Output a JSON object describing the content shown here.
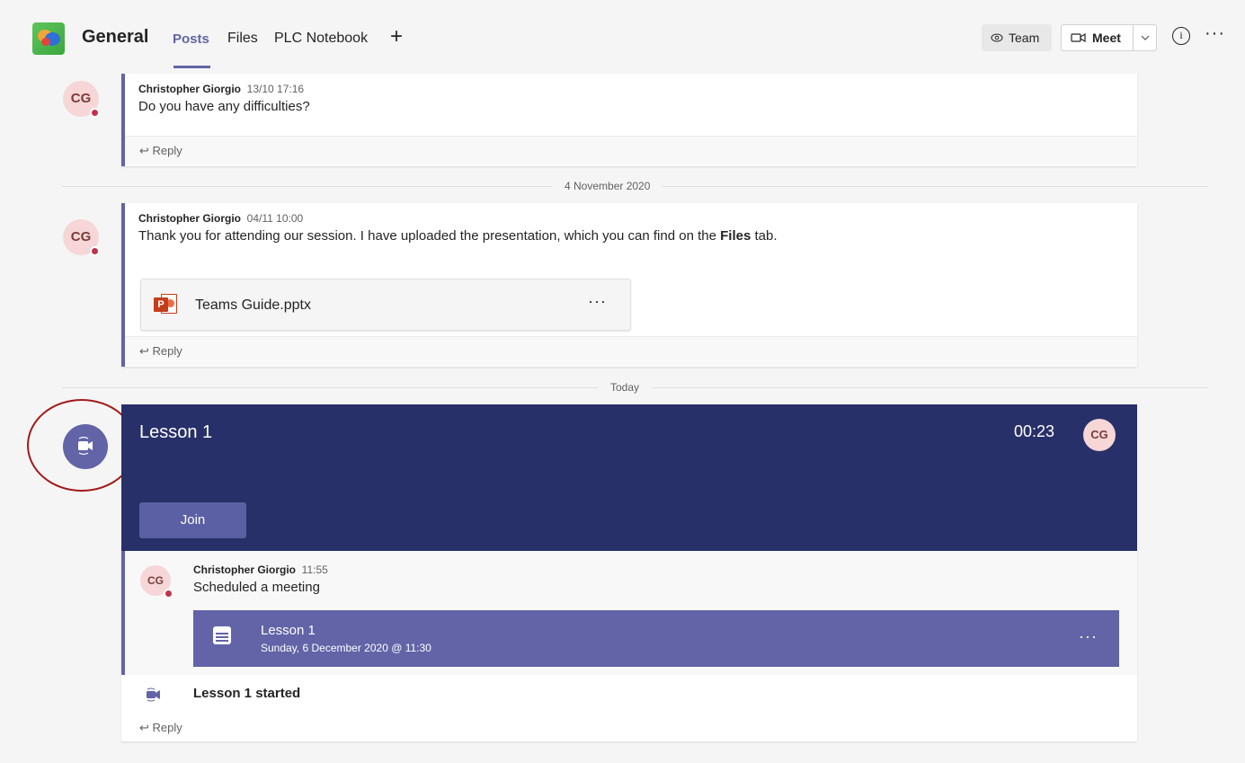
{
  "header": {
    "channel": "General",
    "tabs": [
      "Posts",
      "Files",
      "PLC Notebook"
    ],
    "add_tab": "+",
    "team_button": "Team",
    "meet_button": "Meet",
    "info": "i",
    "more": "···"
  },
  "posts": [
    {
      "author": "Christopher Giorgio",
      "time": "13/10 17:16",
      "text": "Do you have any difficulties?",
      "reply": "Reply",
      "initials": "CG"
    },
    {
      "author": "Christopher Giorgio",
      "time": "04/11 10:00",
      "text_before": "Thank you for attending our session. I have uploaded the presentation, which you can find on the ",
      "text_bold": "Files",
      "text_after": " tab.",
      "attachment": "Teams Guide.pptx",
      "attachment_more": "···",
      "reply": "Reply",
      "initials": "CG"
    }
  ],
  "dividers": {
    "nov": "4 November 2020",
    "today": "Today"
  },
  "meeting": {
    "title": "Lesson 1",
    "timer": "00:23",
    "avatar": "CG",
    "join": "Join",
    "thread_author": "Christopher Giorgio",
    "thread_time": "11:55",
    "thread_text": "Scheduled a meeting",
    "thread_initials": "CG",
    "event_title": "Lesson 1",
    "event_date": "Sunday, 6 December 2020 @ 11:30",
    "event_more": "···",
    "started": "Lesson 1 started",
    "reply": "Reply"
  },
  "colors": {
    "accent": "#6264a7",
    "banner": "#283069",
    "presence": "#c4314b",
    "highlight_ring": "#a11a1a"
  }
}
